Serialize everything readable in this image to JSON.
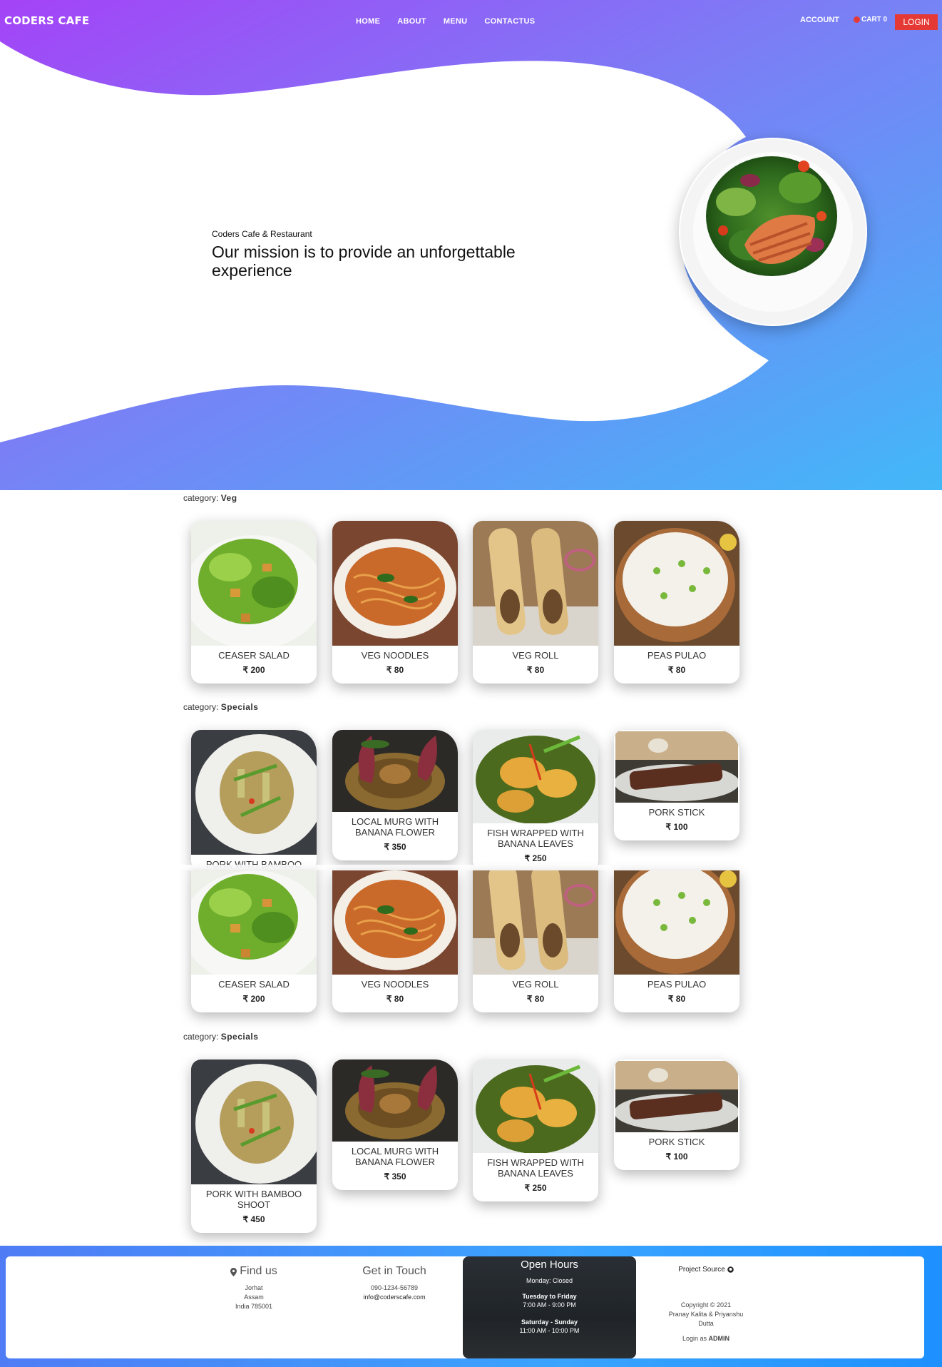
{
  "header": {
    "brand": "CODERS CAFE",
    "nav": [
      "HOME",
      "ABOUT",
      "MENU",
      "CONTACTUS"
    ],
    "account": "ACCOUNT",
    "cart": "CART 0",
    "login": "LOGIN"
  },
  "hero": {
    "subtitle": "Coders Cafe & Restaurant",
    "title": "Our mission is to provide an unforgettable experience"
  },
  "menu": {
    "category_prefix": "category:",
    "sections": [
      {
        "category": "Veg"
      },
      {
        "category": "Specials"
      },
      {
        "category": "Specials"
      }
    ],
    "veg_items": [
      {
        "name": "CEASER SALAD",
        "price": "₹ 200"
      },
      {
        "name": "VEG NOODLES",
        "price": "₹ 80"
      },
      {
        "name": "VEG ROLL",
        "price": "₹ 80"
      },
      {
        "name": "PEAS PULAO",
        "price": "₹ 80"
      }
    ],
    "special_items": [
      {
        "name": "PORK WITH BAMBOO SHOOT",
        "price": "₹ 450"
      },
      {
        "name": "LOCAL MURG WITH BANANA FLOWER",
        "price": "₹ 350"
      },
      {
        "name": "FISH WRAPPED WITH BANANA LEAVES",
        "price": "₹ 250"
      },
      {
        "name": "PORK STICK",
        "price": "₹ 100"
      }
    ],
    "overlap_partial_name": "PORK WITH BAMBOO"
  },
  "footer": {
    "find_us": "Find us",
    "address": [
      "Jorhat",
      "Assam",
      "India 785001"
    ],
    "get_in_touch": "Get in Touch",
    "phone": "090-1234-56789",
    "email": "info@coderscafe.com",
    "hours_title": "Open Hours",
    "monday": "Monday: Closed",
    "weekday_label": "Tuesday to Friday",
    "weekday_hours": "7:00 AM - 9:00 PM",
    "weekend_label": "Saturday - Sunday",
    "weekend_hours": "11:00 AM - 10:00 PM",
    "project_source": "Project Source",
    "copyright": "Copyright © 2021",
    "authors": "Pranay Kalita & Priyanshu Dutta",
    "login_as": "Login as",
    "admin": "ADMIN"
  },
  "colors": {
    "gradient_start": "#a443f7",
    "gradient_mid": "#7b7ef5",
    "gradient_end": "#42b8f8",
    "login_red": "#e53935",
    "footer_blue": "#3aa4ff"
  }
}
